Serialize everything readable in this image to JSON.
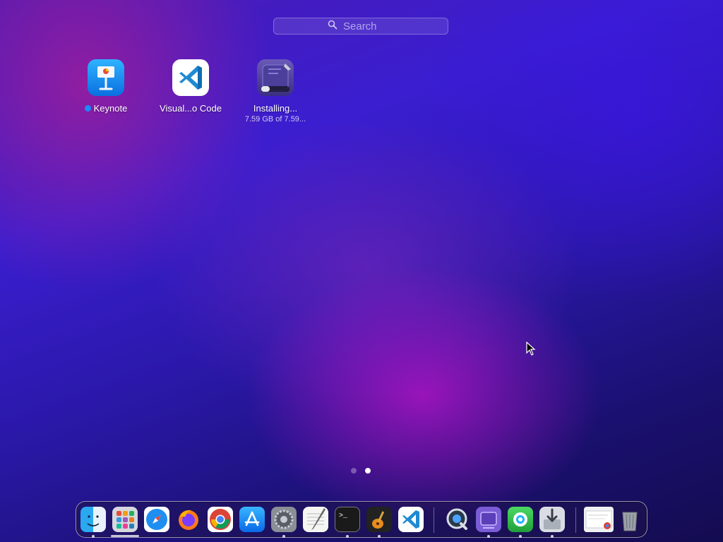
{
  "search": {
    "placeholder": "Search"
  },
  "apps": [
    {
      "label": "Keynote",
      "new": true
    },
    {
      "label": "Visual...o Code"
    },
    {
      "label": "Installing...",
      "sublabel": "7.59 GB of 7.59...",
      "progress": 0.3
    }
  ],
  "pages": {
    "count": 2,
    "current": 2
  },
  "dock": {
    "apps": [
      "Finder",
      "Launchpad",
      "Safari",
      "Firefox",
      "Google Chrome",
      "App Store",
      "System Preferences",
      "TextEdit",
      "Terminal",
      "GarageBand",
      "Visual Studio Code",
      "QuickTime Player",
      "Xcode",
      "Find My",
      "Installer"
    ],
    "others": [
      "Downloads stack",
      "Trash"
    ]
  },
  "colors": {
    "accent": "#1a8cff",
    "dock_border": "#ffffff"
  }
}
